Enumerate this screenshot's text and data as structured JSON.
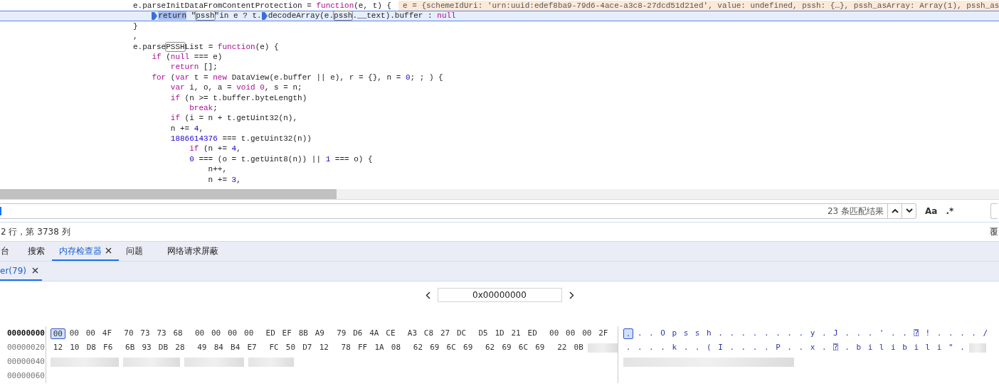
{
  "code_lines": [
    {
      "tokens": [
        {
          "kind": "plain",
          "text": "e.parseInitDataFromContentProtection = "
        },
        {
          "kind": "kw",
          "text": "function"
        },
        {
          "kind": "plain",
          "text": "(e, t) {"
        },
        {
          "kind": "inline-value",
          "text": "e = {schemeIdUri: 'urn:uuid:edef8ba9-79d6-4ace-a3c8-27dcd51d21ed', value: undefined, pssh: {…}, pssh_asArray: Array(1), pssh_as"
        }
      ],
      "paused": false,
      "children": [
        {
          "paused": true,
          "tokens": [
            {
              "kind": "marker"
            },
            {
              "kind": "current-match",
              "text": "return"
            },
            {
              "kind": "plain",
              "text": " \""
            },
            {
              "kind": "match",
              "text": "pssh"
            },
            {
              "kind": "plain",
              "text": "\"in e ? t."
            },
            {
              "kind": "marker"
            },
            {
              "kind": "plain",
              "text": "decodeArray(e."
            },
            {
              "kind": "match",
              "text": "pssh"
            },
            {
              "kind": "plain",
              "text": ".__text).buffer : "
            },
            {
              "kind": "kw",
              "text": "null"
            }
          ]
        }
      ]
    },
    {
      "paused": false,
      "tokens": [
        {
          "kind": "plain",
          "text": "}"
        }
      ]
    },
    {
      "paused": false,
      "tokens": [
        {
          "kind": "plain",
          "text": ","
        }
      ]
    },
    {
      "paused": false,
      "tokens": [
        {
          "kind": "plain",
          "text": "e.parse"
        },
        {
          "kind": "match",
          "text": "PSSH"
        },
        {
          "kind": "plain",
          "text": "List = "
        },
        {
          "kind": "kw",
          "text": "function"
        },
        {
          "kind": "plain",
          "text": "(e) {"
        }
      ],
      "children": [
        {
          "paused": false,
          "tokens": [
            {
              "kind": "kw",
              "text": "if"
            },
            {
              "kind": "plain",
              "text": " ("
            },
            {
              "kind": "kw",
              "text": "null"
            },
            {
              "kind": "plain",
              "text": " === e)"
            }
          ],
          "children": [
            {
              "paused": false,
              "tokens": [
                {
                  "kind": "kw",
                  "text": "return"
                },
                {
                  "kind": "plain",
                  "text": " [];"
                }
              ]
            }
          ]
        },
        {
          "paused": false,
          "tokens": [
            {
              "kind": "kw",
              "text": "for"
            },
            {
              "kind": "plain",
              "text": " ("
            },
            {
              "kind": "kw",
              "text": "var"
            },
            {
              "kind": "plain",
              "text": " t = "
            },
            {
              "kind": "kw",
              "text": "new"
            },
            {
              "kind": "plain",
              "text": " DataView(e.buffer || e), r = {}, n = "
            },
            {
              "kind": "num",
              "text": "0"
            },
            {
              "kind": "plain",
              "text": "; ; ) {"
            }
          ],
          "children": [
            {
              "paused": false,
              "tokens": [
                {
                  "kind": "kw",
                  "text": "var"
                },
                {
                  "kind": "plain",
                  "text": " i, o, a = "
                },
                {
                  "kind": "kw",
                  "text": "void 0"
                },
                {
                  "kind": "plain",
                  "text": ", s = n;"
                }
              ]
            },
            {
              "paused": false,
              "tokens": [
                {
                  "kind": "kw",
                  "text": "if"
                },
                {
                  "kind": "plain",
                  "text": " (n >= t.buffer.byteLength)"
                }
              ],
              "children": [
                {
                  "paused": false,
                  "tokens": [
                    {
                      "kind": "kw",
                      "text": "break"
                    },
                    {
                      "kind": "plain",
                      "text": ";"
                    }
                  ]
                }
              ]
            },
            {
              "paused": false,
              "tokens": [
                {
                  "kind": "kw",
                  "text": "if"
                },
                {
                  "kind": "plain",
                  "text": " (i = n + t.getUint32(n),"
                }
              ]
            },
            {
              "paused": false,
              "tokens": [
                {
                  "kind": "plain",
                  "text": "n += "
                },
                {
                  "kind": "num",
                  "text": "4"
                },
                {
                  "kind": "plain",
                  "text": ","
                }
              ]
            },
            {
              "paused": false,
              "tokens": [
                {
                  "kind": "num",
                  "text": "1886614376"
                },
                {
                  "kind": "plain",
                  "text": " === t.getUint32(n))"
                }
              ],
              "children": [
                {
                  "paused": false,
                  "tokens": [
                    {
                      "kind": "kw",
                      "text": "if"
                    },
                    {
                      "kind": "plain",
                      "text": " (n += "
                    },
                    {
                      "kind": "num",
                      "text": "4"
                    },
                    {
                      "kind": "plain",
                      "text": ","
                    }
                  ]
                },
                {
                  "paused": false,
                  "tokens": [
                    {
                      "kind": "num",
                      "text": "0"
                    },
                    {
                      "kind": "plain",
                      "text": " === (o = t.getUint8(n)) || "
                    },
                    {
                      "kind": "num",
                      "text": "1"
                    },
                    {
                      "kind": "plain",
                      "text": " === o) {"
                    }
                  ],
                  "children": [
                    {
                      "paused": false,
                      "tokens": [
                        {
                          "kind": "plain",
                          "text": "n++,"
                        }
                      ]
                    },
                    {
                      "paused": false,
                      "tokens": [
                        {
                          "kind": "plain",
                          "text": "n += "
                        },
                        {
                          "kind": "num",
                          "text": "3"
                        },
                        {
                          "kind": "plain",
                          "text": ","
                        }
                      ]
                    }
                  ]
                }
              ]
            }
          ]
        }
      ]
    }
  ],
  "search": {
    "match_count": "23 条匹配结果",
    "case_button": "Aa",
    "regex_button": ".*"
  },
  "status": {
    "position": "2 行，第 3738 列",
    "right_text": "覆"
  },
  "tabs": [
    {
      "label": "台",
      "selected": false,
      "closable": false
    },
    {
      "label": "搜索",
      "selected": false,
      "closable": false
    },
    {
      "label": "内存检查器",
      "selected": true,
      "closable": true
    },
    {
      "label": "问题",
      "selected": false,
      "closable": false
    },
    {
      "label": "网络请求屏蔽",
      "selected": false,
      "closable": false
    }
  ],
  "subtabs": [
    {
      "label": "er(79)",
      "selected": true
    }
  ],
  "address_field": {
    "value": "0x00000000"
  },
  "hex_rows": [
    {
      "address": "00000000",
      "active": true,
      "kind": "full",
      "cursor_at_start": true,
      "bytes": [
        "00",
        "00",
        "00",
        "4F",
        "70",
        "73",
        "73",
        "68",
        "00",
        "00",
        "00",
        "00",
        "ED",
        "EF",
        "8B",
        "A9",
        "79",
        "D6",
        "4A",
        "CE",
        "A3",
        "C8",
        "27",
        "DC",
        "D5",
        "1D",
        "21",
        "ED",
        "00",
        "00",
        "00",
        "2F"
      ],
      "ascii": [
        ".",
        ".",
        ".",
        "O",
        "p",
        "s",
        "s",
        "h",
        ".",
        ".",
        ".",
        ".",
        ".",
        ".",
        ".",
        ".",
        "y",
        ".",
        "J",
        ".",
        ".",
        ".",
        "'",
        ".",
        ".",
        "⍰",
        "!",
        ".",
        ".",
        ".",
        ".",
        "/"
      ]
    },
    {
      "address": "00000020",
      "active": false,
      "kind": "partly-blurred",
      "cursor_at_start": false,
      "bytes": [
        "12",
        "10",
        "D8",
        "F6",
        "6B",
        "93",
        "DB",
        "28",
        "49",
        "84",
        "B4",
        "E7",
        "FC",
        "50",
        "D7",
        "12",
        "78",
        "FF",
        "1A",
        "08",
        "62",
        "69",
        "6C",
        "69",
        "62",
        "69",
        "6C",
        "69",
        "22",
        "0B"
      ],
      "ascii": [
        ".",
        ".",
        ".",
        ".",
        "k",
        ".",
        ".",
        "(",
        "I",
        ".",
        ".",
        ".",
        ".",
        "P",
        ".",
        ".",
        "x",
        ".",
        "⍰",
        ".",
        "b",
        "i",
        "l",
        "i",
        "b",
        "i",
        "l",
        "i",
        "\"",
        "."
      ]
    },
    {
      "address": "00000040",
      "active": false,
      "kind": "blurred"
    },
    {
      "address": "00000060",
      "active": false,
      "kind": "empty"
    }
  ]
}
